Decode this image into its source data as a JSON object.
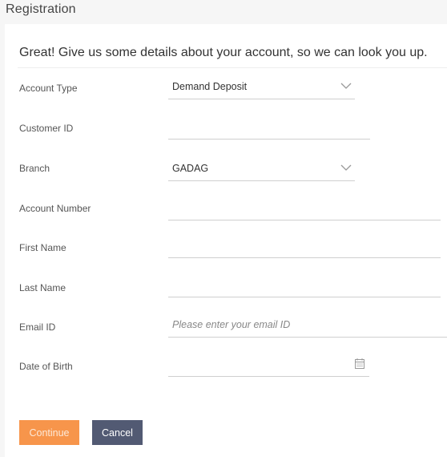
{
  "header": {
    "title": "Registration"
  },
  "form": {
    "intro": "Great! Give us some details about your account, so we can look you up.",
    "fields": {
      "account_type": {
        "label": "Account Type",
        "value": "Demand Deposit",
        "icon": "chevron-down-icon"
      },
      "customer_id": {
        "label": "Customer ID",
        "value": ""
      },
      "branch": {
        "label": "Branch",
        "value": "GADAG",
        "icon": "chevron-down-icon"
      },
      "account_number": {
        "label": "Account Number",
        "value": ""
      },
      "first_name": {
        "label": "First Name",
        "value": ""
      },
      "last_name": {
        "label": "Last Name",
        "value": ""
      },
      "email_id": {
        "label": "Email ID",
        "value": "",
        "placeholder": "Please enter your email ID"
      },
      "date_of_birth": {
        "label": "Date of Birth",
        "value": "",
        "icon": "calendar-icon"
      }
    },
    "buttons": {
      "continue": "Continue",
      "cancel": "Cancel"
    }
  },
  "colors": {
    "primary_button": "#f7954b",
    "secondary_button": "#525a73",
    "background": "#f6f6f6"
  }
}
